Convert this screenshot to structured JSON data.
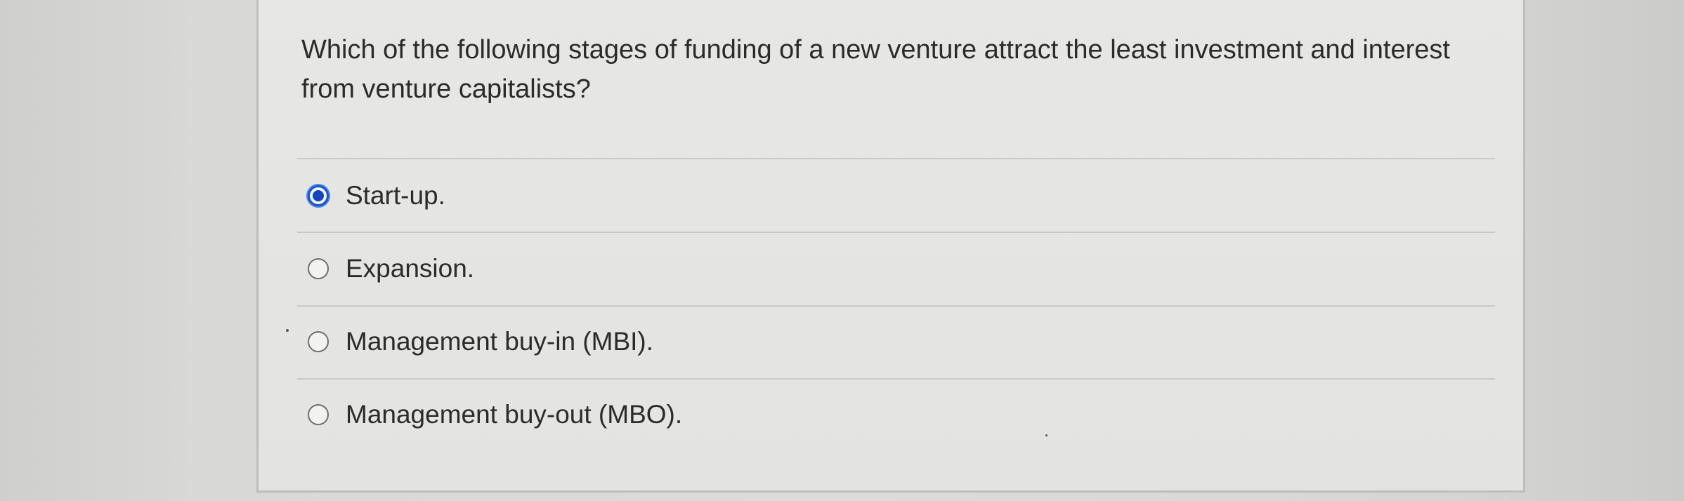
{
  "question": {
    "text": "Which of the following stages of funding of a new venture attract the least investment and interest from venture capitalists?"
  },
  "options": [
    {
      "label": "Start-up.",
      "selected": true
    },
    {
      "label": "Expansion.",
      "selected": false
    },
    {
      "label": "Management buy-in (MBI).",
      "selected": false
    },
    {
      "label": "Management buy-out (MBO).",
      "selected": false
    }
  ],
  "colors": {
    "selected_radio": "#1346b8",
    "text": "#2b2b2b",
    "card_background": "#e5e5e3"
  }
}
